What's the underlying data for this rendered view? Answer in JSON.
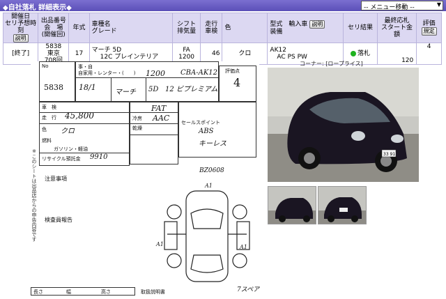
{
  "window": {
    "title": "◆自社落札 詳細表示◆"
  },
  "menu": {
    "selected": "-- メニュー移動 --"
  },
  "header": {
    "c1": [
      "開催日",
      "セリ予想時刻"
    ],
    "c1_button": "説明",
    "c2": [
      "出品番号",
      "会　場",
      "(開催回)"
    ],
    "c3": "年式",
    "c4": [
      "車種名",
      "グレード"
    ],
    "c5": [
      "シフト",
      "排気量"
    ],
    "c6": [
      "走行",
      "車検"
    ],
    "c7": "色",
    "c8": [
      "型式　輸入車",
      "装備"
    ],
    "c8_button": "説明",
    "c9": "セリ結果",
    "c10": [
      "最終応札",
      "スタート金額"
    ],
    "c11": "評価",
    "c11_button": "規定"
  },
  "row": {
    "status": "[終了]",
    "lot": "5838",
    "venue": "東京",
    "session": "708回",
    "year": "17",
    "model": "マーチ 5D",
    "grade": "12C プレインテリア",
    "shift": "FA",
    "displacement": "1200",
    "mileage": "46",
    "color": "クロ",
    "type": "AK12",
    "equipment": "AC PS PW",
    "result": "落札",
    "price": "120",
    "score": "4"
  },
  "sheet": {
    "lot_no": "5838",
    "line1": "事・自",
    "line2": "自家用・レンター・(　　)",
    "model_hand": "マーチ",
    "cc_hand": "1200",
    "type_hand": "CBA-AK12",
    "year_hand": "18/1",
    "body_hand": "5D",
    "grade_hand": "12 ビプレミアム",
    "score_label": "評価点",
    "score_hand": "4",
    "labels": [
      "車　検",
      "走　行",
      "色",
      "燃料",
      "ガソリン・軽油",
      "リサイクル預託金",
      "冷房",
      "乾燥",
      "セールスポイント",
      "注意事項",
      "検査員報告"
    ],
    "mileage_hand": "45,800",
    "color_hand": "クロ",
    "shift_hand": "FAT",
    "ac_hand": "AAC",
    "sales_hand": [
      "ABS",
      "キーレス"
    ],
    "recycle_hand": "9910",
    "code_hand": "BZ0608",
    "footer": [
      "長さ",
      "幅",
      "高さ",
      "取扱説明書",
      "7スペア"
    ],
    "damage_marks": [
      "A1",
      "A1",
      "A1"
    ]
  },
  "photos": {
    "corner": "コーナー: [ロープライス]",
    "plate": "33 91"
  }
}
